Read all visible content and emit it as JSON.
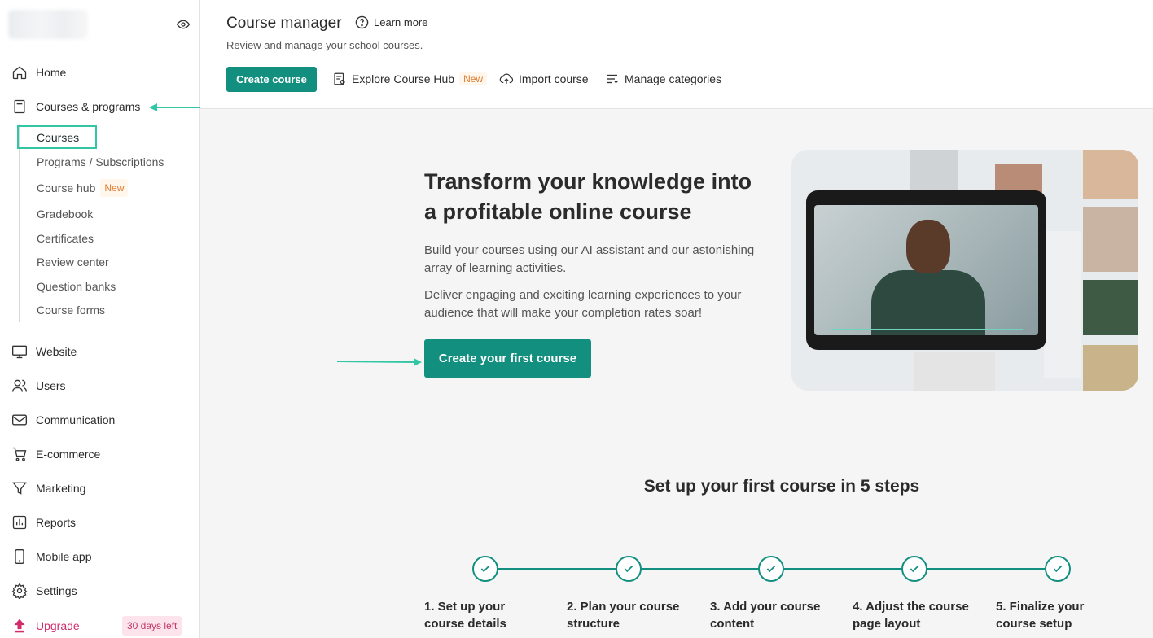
{
  "sidebar": {
    "items": [
      {
        "label": "Home",
        "icon": "home-icon"
      },
      {
        "label": "Courses & programs",
        "icon": "book-icon"
      },
      {
        "label": "Website",
        "icon": "monitor-icon"
      },
      {
        "label": "Users",
        "icon": "users-icon"
      },
      {
        "label": "Communication",
        "icon": "mail-icon"
      },
      {
        "label": "E-commerce",
        "icon": "cart-icon"
      },
      {
        "label": "Marketing",
        "icon": "funnel-icon"
      },
      {
        "label": "Reports",
        "icon": "chart-icon"
      },
      {
        "label": "Mobile app",
        "icon": "phone-icon"
      },
      {
        "label": "Settings",
        "icon": "gear-icon"
      },
      {
        "label": "Upgrade",
        "icon": "upgrade-icon"
      }
    ],
    "subitems": [
      {
        "label": "Courses"
      },
      {
        "label": "Programs / Subscriptions"
      },
      {
        "label": "Course hub",
        "badge": "New"
      },
      {
        "label": "Gradebook"
      },
      {
        "label": "Certificates"
      },
      {
        "label": "Review center"
      },
      {
        "label": "Question banks"
      },
      {
        "label": "Course forms"
      }
    ],
    "trial_badge": "30 days left"
  },
  "header": {
    "title": "Course manager",
    "learn_more": "Learn more",
    "subtitle": "Review and manage your school courses.",
    "create_course": "Create course",
    "explore_hub": "Explore Course Hub",
    "explore_badge": "New",
    "import_course": "Import course",
    "manage_categories": "Manage categories"
  },
  "hero": {
    "title": "Transform your knowledge into a profitable online course",
    "p1": "Build your courses using our AI assistant and our astonishing array of learning activities.",
    "p2": "Deliver engaging and exciting learning experiences to your audience that will make your completion rates soar!",
    "cta": "Create your first course"
  },
  "steps": {
    "title": "Set up your first course in 5 steps",
    "items": [
      {
        "label": "1. Set up your course details"
      },
      {
        "label": "2. Plan your course structure"
      },
      {
        "label": "3. Add your course content"
      },
      {
        "label": "4. Adjust the course page layout"
      },
      {
        "label": "5. Finalize your course setup"
      }
    ]
  },
  "colors": {
    "accent": "#138f80",
    "highlight": "#32c6a5",
    "new_badge": "#e07a2f",
    "upgrade": "#d12d6b"
  }
}
